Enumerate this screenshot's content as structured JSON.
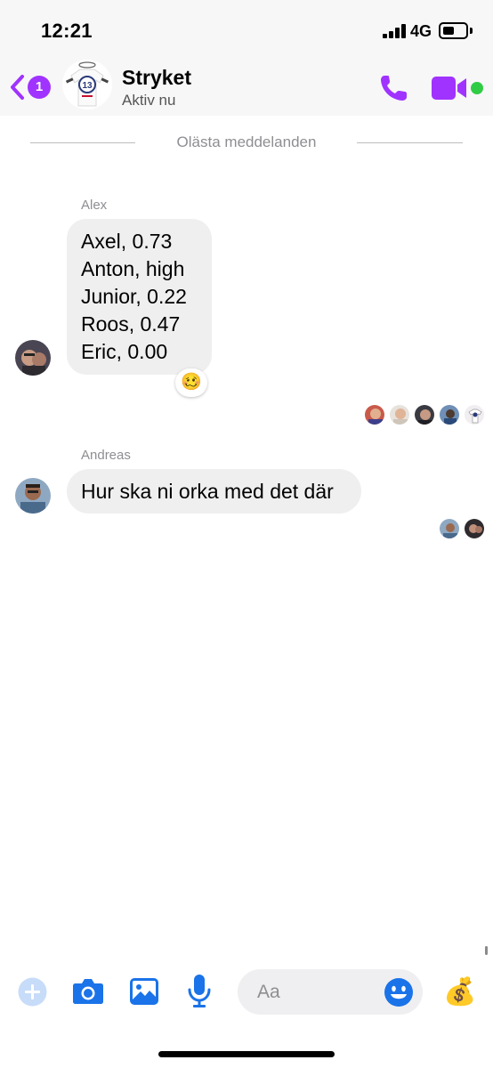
{
  "status_bar": {
    "time": "12:21",
    "network": "4G",
    "battery_level": 0.5
  },
  "header": {
    "back_badge_count": "1",
    "title": "Stryket",
    "subtitle": "Aktiv nu",
    "group_avatar_number": "13",
    "accent_color": "#a033ff",
    "active_color": "#31cc46",
    "icons": [
      "chevron-left-icon",
      "phone-icon",
      "video-camera-icon"
    ]
  },
  "divider": {
    "label": "Olästa meddelanden"
  },
  "messages": [
    {
      "sender": "Alex",
      "lines": [
        "Axel, 0.73",
        "Anton, high",
        "Junior, 0.22",
        "Roos, 0.47",
        "Eric, 0.00"
      ],
      "reaction": "🥴",
      "seen_by_count": 5
    },
    {
      "sender": "Andreas",
      "lines": [
        "Hur ska ni orka med det där"
      ],
      "seen_by_count": 2
    }
  ],
  "composer": {
    "placeholder": "Aa",
    "quick_reaction": "💰",
    "icons": [
      "plus-icon",
      "camera-icon",
      "image-icon",
      "microphone-icon",
      "smiley-icon"
    ],
    "icon_color": "#1a73e8"
  }
}
